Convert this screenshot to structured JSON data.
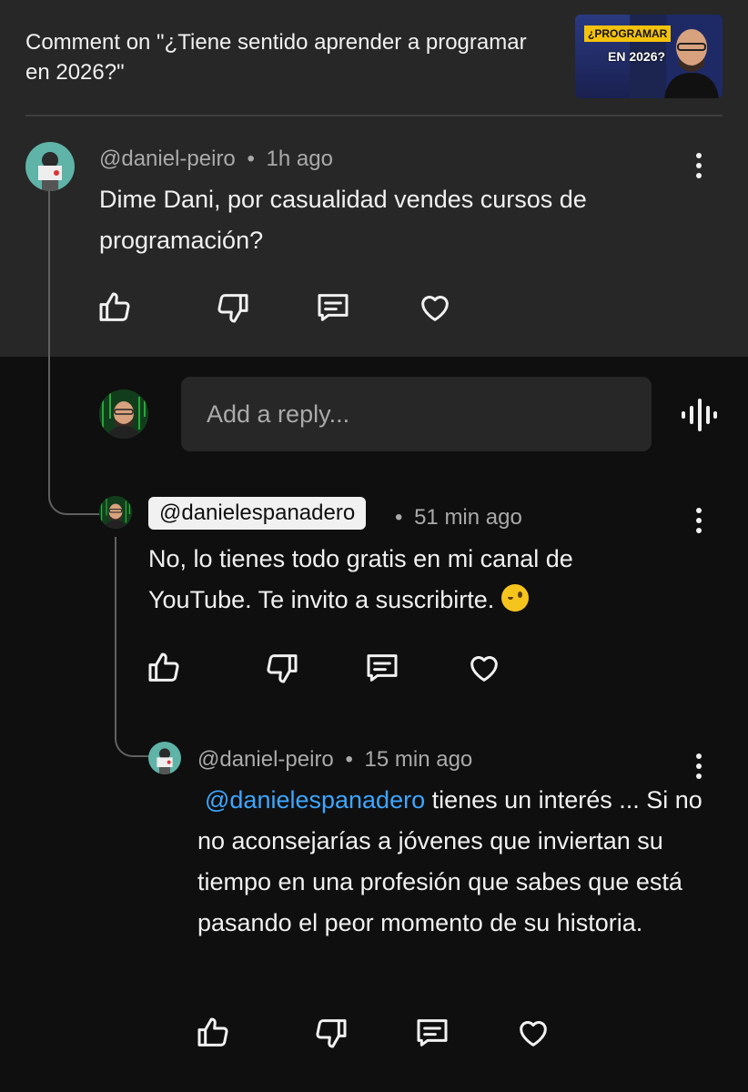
{
  "header": {
    "title": "Comment on \"¿Tiene sentido aprender a programar en 2026?\"",
    "thumbnail": {
      "line1": "¿PROGRAMAR",
      "line2": "EN 2026?"
    }
  },
  "comments": [
    {
      "author": "@daniel-peiro",
      "time": "1h ago",
      "text": "Dime Dani, por casualidad vendes cursos de programación?"
    },
    {
      "author": "@danielespanadero",
      "time": "51 min ago",
      "text": "No, lo tienes todo gratis en mi canal de YouTube. Te invito a suscribirte."
    },
    {
      "author": "@daniel-peiro",
      "time": "15 min ago",
      "mention": "@danielespanadero",
      "text": " tienes un interés ... Si no no aconsejarías a jóvenes que inviertan su tiempo en una profesión que sabes que está pasando el peor momento de su historia."
    }
  ],
  "reply": {
    "placeholder": "Add a reply..."
  },
  "sep": "•",
  "icons": [
    "like-icon",
    "dislike-icon",
    "reply-icon",
    "heart-icon",
    "more-vert-icon",
    "voice-search-icon",
    "wink-emoji-icon"
  ],
  "colors": {
    "top_bg": "#272727",
    "page_bg": "#0f0f0f",
    "link": "#3ea6ff",
    "meta": "#aaaaaa"
  }
}
